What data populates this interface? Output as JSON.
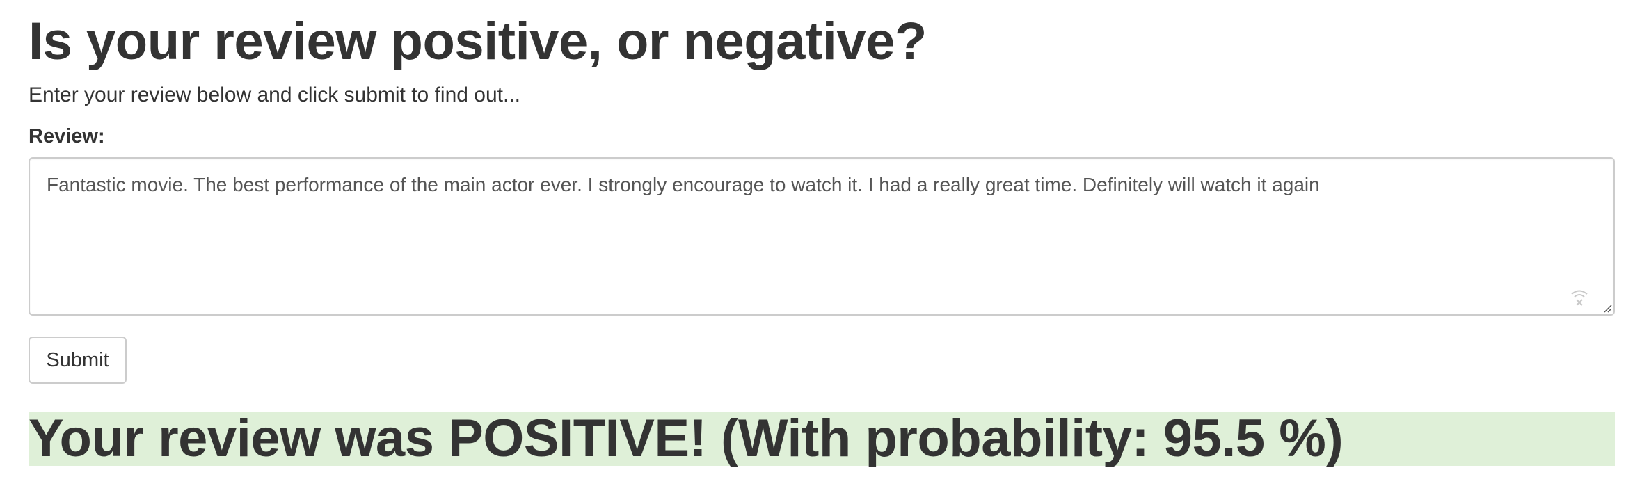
{
  "page": {
    "title": "Is your review positive, or negative?",
    "subtitle": "Enter your review below and click submit to find out..."
  },
  "form": {
    "label": "Review:",
    "review_value": "Fantastic movie. The best performance of the main actor ever. I strongly encourage to watch it. I had a really great time. Definitely will watch it again",
    "submit_label": "Submit"
  },
  "result": {
    "text": "Your review was POSITIVE! (With probability: 95.5 %)",
    "background_color": "#dff0d8"
  },
  "icons": {
    "textarea_extension_icon": "grammar-extension-icon",
    "resize_icon": "resize-handle-icon"
  }
}
